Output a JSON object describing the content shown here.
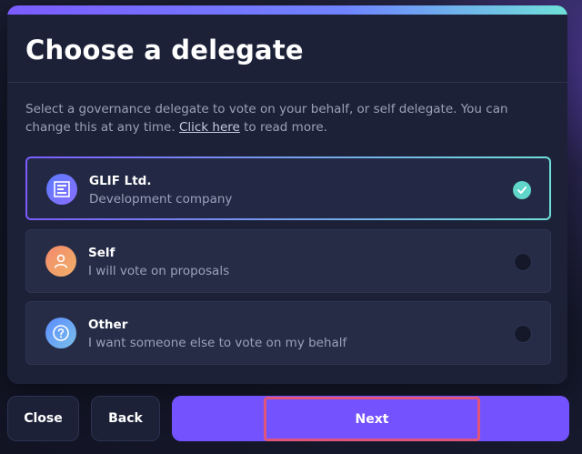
{
  "modal": {
    "title": "Choose a delegate",
    "description_before": "Select a governance delegate to vote on your behalf, or self delegate. You can change this at any time. ",
    "description_link": "Click here",
    "description_after": " to read more."
  },
  "options": [
    {
      "title": "GLIF Ltd.",
      "subtitle": "Development company",
      "icon": "glif-logo-icon",
      "selected": true
    },
    {
      "title": "Self",
      "subtitle": "I will vote on proposals",
      "icon": "user-icon",
      "selected": false
    },
    {
      "title": "Other",
      "subtitle": "I want someone else to vote on my behalf",
      "icon": "question-icon",
      "selected": false
    }
  ],
  "footer": {
    "close_label": "Close",
    "back_label": "Back",
    "next_label": "Next"
  },
  "colors": {
    "accent": "#7453ff",
    "check": "#5fd6c9",
    "highlight": "#e0557a"
  }
}
